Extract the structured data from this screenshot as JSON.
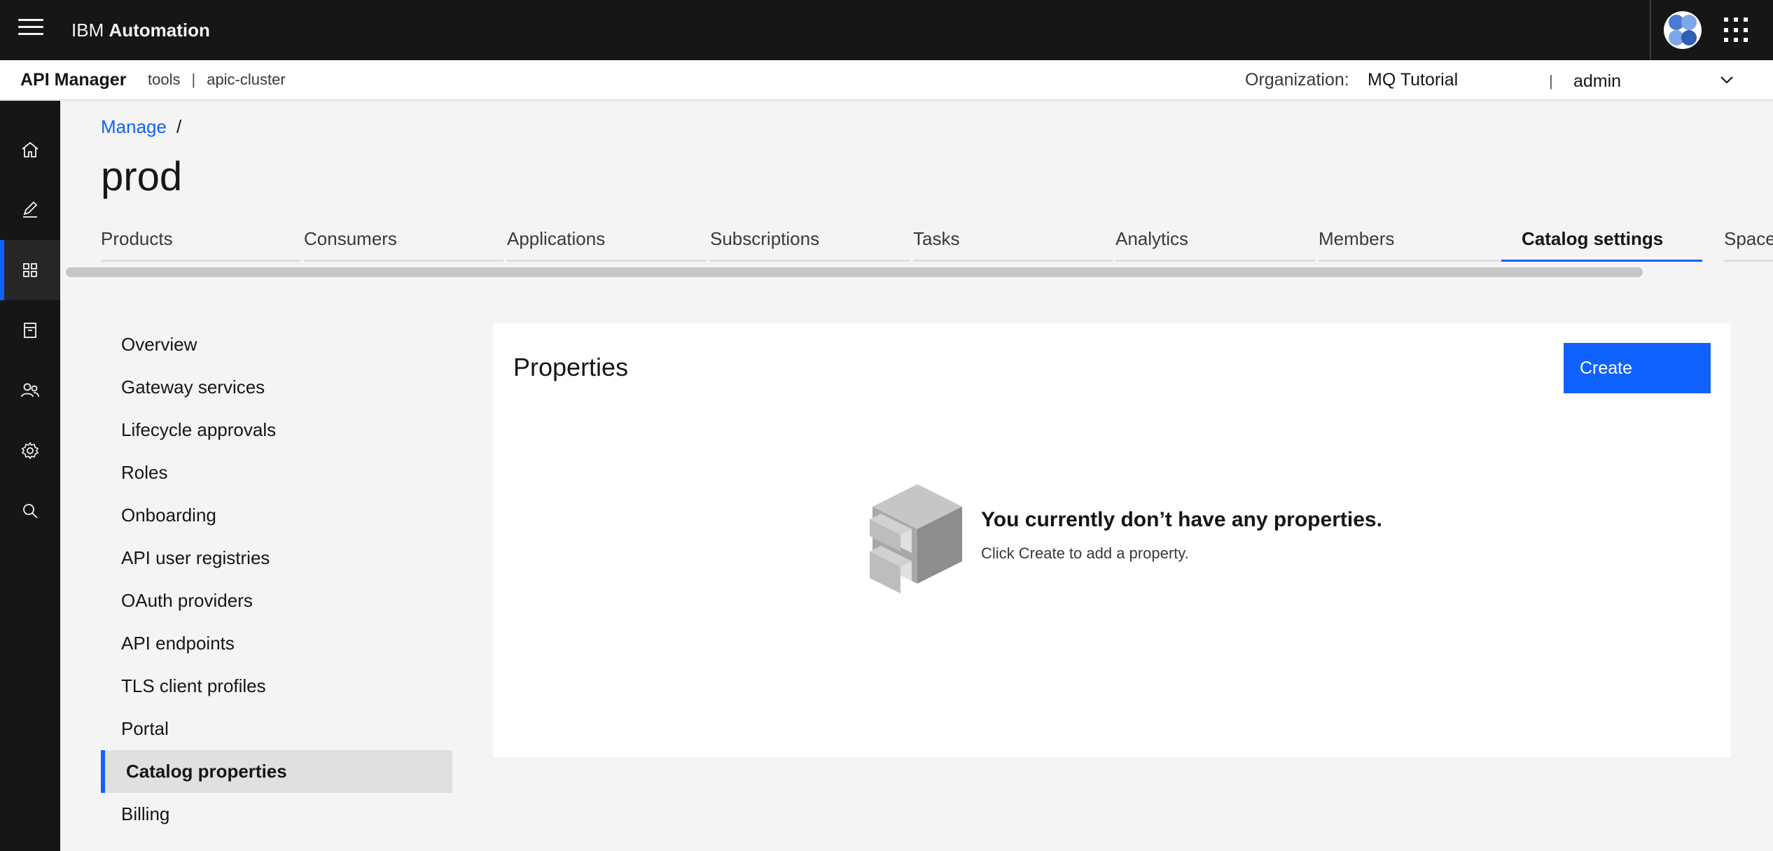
{
  "shell": {
    "brand_prefix": "IBM",
    "brand_name": "Automation",
    "menu_icon": "menu-icon",
    "switcher_icon": "app-switcher-icon"
  },
  "subheader": {
    "app_name": "API Manager",
    "context_1": "tools",
    "context_sep": "|",
    "context_2": "apic-cluster",
    "org_label": "Organization:",
    "org_value": "MQ Tutorial",
    "pipe": "|",
    "user": "admin"
  },
  "rail": {
    "items": [
      {
        "icon": "home-icon"
      },
      {
        "icon": "edit-icon"
      },
      {
        "icon": "manage-icon"
      },
      {
        "icon": "archive-icon"
      },
      {
        "icon": "users-icon"
      },
      {
        "icon": "settings-icon"
      },
      {
        "icon": "search-icon"
      }
    ]
  },
  "breadcrumb": {
    "link": "Manage",
    "separator": "/"
  },
  "page_title": "prod",
  "tabs": [
    {
      "label": "Products"
    },
    {
      "label": "Consumers"
    },
    {
      "label": "Applications"
    },
    {
      "label": "Subscriptions"
    },
    {
      "label": "Tasks"
    },
    {
      "label": "Analytics"
    },
    {
      "label": "Members"
    },
    {
      "label": "Catalog settings",
      "active": true
    },
    {
      "label": "Spaces"
    }
  ],
  "subnav": [
    {
      "label": "Overview"
    },
    {
      "label": "Gateway services"
    },
    {
      "label": "Lifecycle approvals"
    },
    {
      "label": "Roles"
    },
    {
      "label": "Onboarding"
    },
    {
      "label": "API user registries"
    },
    {
      "label": "OAuth providers"
    },
    {
      "label": "API endpoints"
    },
    {
      "label": "TLS client profiles"
    },
    {
      "label": "Portal"
    },
    {
      "label": "Catalog properties",
      "active": true
    },
    {
      "label": "Billing"
    }
  ],
  "properties": {
    "title": "Properties",
    "create_label": "Create",
    "empty_heading": "You currently don’t have any properties.",
    "empty_body": "Click Create to add a property."
  },
  "colors": {
    "accent": "#0f62fe",
    "shell": "#161616",
    "background": "#f4f4f4"
  }
}
